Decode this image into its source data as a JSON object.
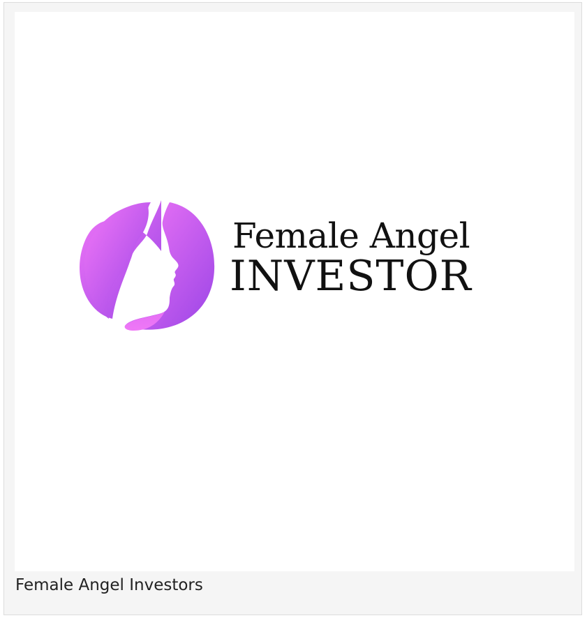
{
  "logo": {
    "line1": "Female Angel",
    "line2": "INVESTOR",
    "icon": "female-profile-circle-icon",
    "gradient_start": "#f277f7",
    "gradient_end": "#9b45e6"
  },
  "caption": "Female Angel Investors"
}
